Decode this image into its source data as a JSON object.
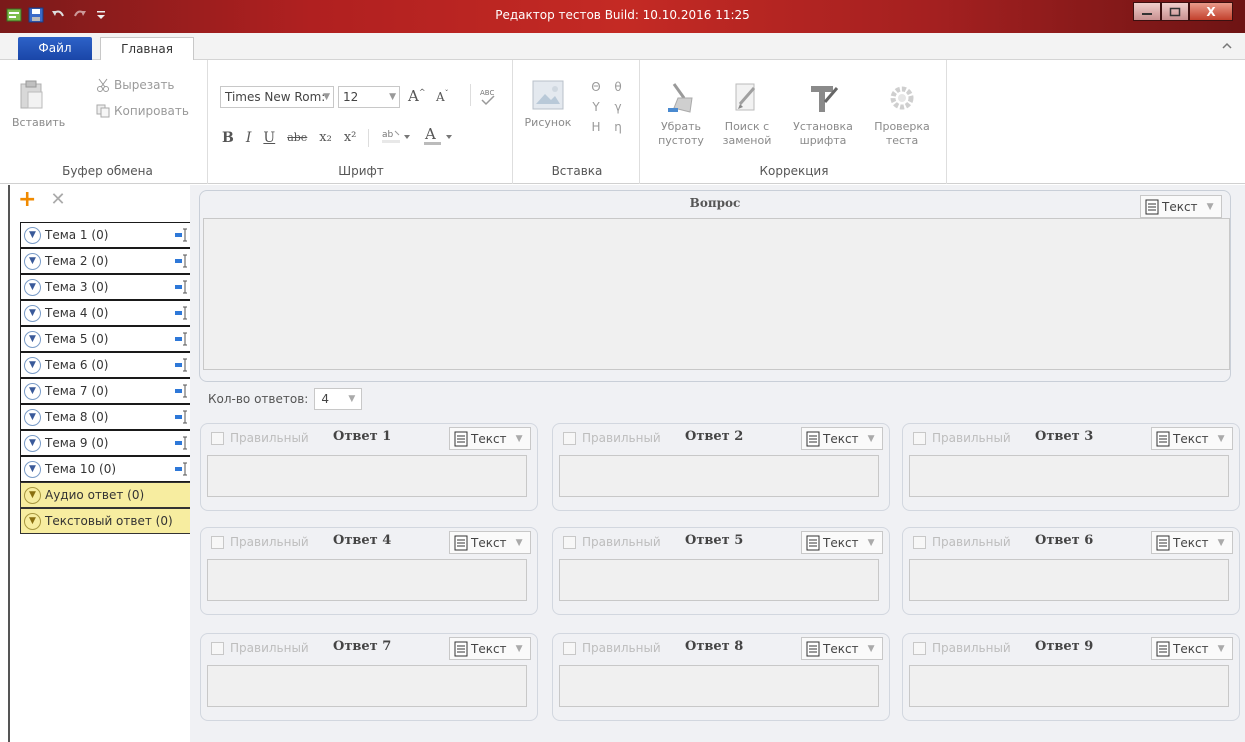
{
  "window": {
    "title": "Редактор тестов Build: 10.10.2016 11:25",
    "minimize_icon": "minimize-icon",
    "maximize_icon": "maximize-icon",
    "close_label": "X"
  },
  "quick_access": [
    "app-icon",
    "save-icon",
    "undo-icon",
    "redo-icon",
    "customize-icon"
  ],
  "tabs": {
    "file": "Файл",
    "home": "Главная"
  },
  "ribbon": {
    "clipboard": {
      "paste": "Вставить",
      "cut": "Вырезать",
      "copy": "Копировать",
      "label": "Буфер обмена"
    },
    "font": {
      "family": "Times New Rom:",
      "size": "12",
      "label": "Шрифт",
      "bold": "B",
      "italic": "I",
      "underline": "U",
      "strike": "abe",
      "sub": "x₂",
      "sup": "x²"
    },
    "insert": {
      "picture": "Рисунок",
      "label": "Вставка",
      "symbols": [
        "Θ",
        "θ",
        "Υ",
        "γ",
        "Η",
        "η"
      ]
    },
    "correction": {
      "clean_line1": "Убрать",
      "clean_line2": "пустоту",
      "replace_line1": "Поиск с",
      "replace_line2": "заменой",
      "setfont_line1": "Установка",
      "setfont_line2": "шрифта",
      "check_line1": "Проверка",
      "check_line2": "теста",
      "label": "Коррекция"
    }
  },
  "topics": [
    {
      "label": "Тема 1 (0)"
    },
    {
      "label": "Тема 2 (0)"
    },
    {
      "label": "Тема 3 (0)"
    },
    {
      "label": "Тема 4 (0)"
    },
    {
      "label": "Тема 5 (0)"
    },
    {
      "label": "Тема 6 (0)"
    },
    {
      "label": "Тема 7 (0)"
    },
    {
      "label": "Тема 8 (0)"
    },
    {
      "label": "Тема 9 (0)"
    },
    {
      "label": "Тема 10 (0)"
    },
    {
      "label": "Аудио ответ (0)"
    },
    {
      "label": "Текстовый ответ (0)"
    }
  ],
  "question": {
    "title": "Вопрос",
    "format": "Текст"
  },
  "answer_count": {
    "label": "Кол-во ответов:",
    "value": "4"
  },
  "answers": [
    {
      "title": "Ответ 1",
      "correct": "Правильный",
      "format": "Текст"
    },
    {
      "title": "Ответ 2",
      "correct": "Правильный",
      "format": "Текст"
    },
    {
      "title": "Ответ 3",
      "correct": "Правильный",
      "format": "Текст"
    },
    {
      "title": "Ответ 4",
      "correct": "Правильный",
      "format": "Текст"
    },
    {
      "title": "Ответ 5",
      "correct": "Правильный",
      "format": "Текст"
    },
    {
      "title": "Ответ 6",
      "correct": "Правильный",
      "format": "Текст"
    },
    {
      "title": "Ответ 7",
      "correct": "Правильный",
      "format": "Текст"
    },
    {
      "title": "Ответ 8",
      "correct": "Правильный",
      "format": "Текст"
    },
    {
      "title": "Ответ 9",
      "correct": "Правильный",
      "format": "Текст"
    }
  ],
  "colors": {
    "titlebar": "#b02020",
    "file_tab": "#1a46a8",
    "accent_add": "#f08a00",
    "special_topic": "#f7eda0"
  }
}
